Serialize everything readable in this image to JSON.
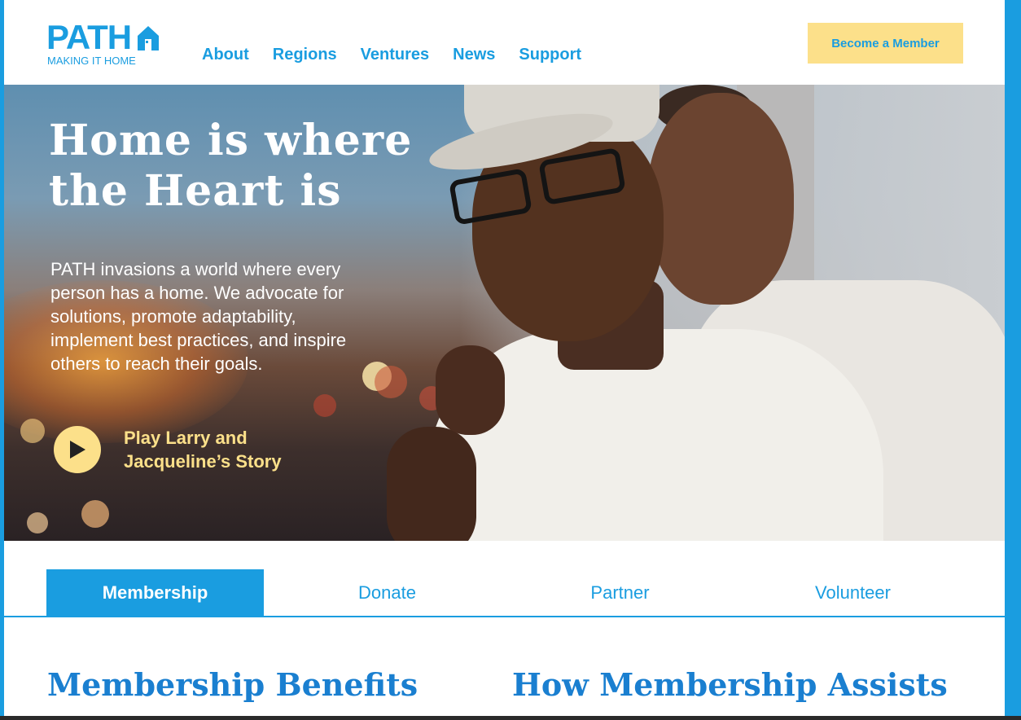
{
  "brand": {
    "name": "PATH",
    "tagline": "MAKING IT HOME"
  },
  "nav": {
    "items": [
      {
        "label": "About"
      },
      {
        "label": "Regions"
      },
      {
        "label": "Ventures"
      },
      {
        "label": "News"
      },
      {
        "label": "Support"
      }
    ],
    "cta_label": "Become a Member"
  },
  "hero": {
    "title": "Home is where the Heart is",
    "description": "PATH invasions a world where every person has a home. We advocate for solutions, promote adaptability, implement best practices, and inspire others to reach their goals.",
    "play_label": "Play Larry and Jacqueline’s Story"
  },
  "tabs": [
    {
      "label": "Membership",
      "active": true
    },
    {
      "label": "Donate",
      "active": false
    },
    {
      "label": "Partner",
      "active": false
    },
    {
      "label": "Volunteer",
      "active": false
    }
  ],
  "sections": {
    "left_title": "Membership Benefits",
    "right_title": "How Membership Assists"
  },
  "colors": {
    "brand_blue": "#1a9de0",
    "accent_yellow": "#fce08a"
  },
  "icons": {
    "play": "play-icon",
    "logo_house": "house-icon"
  }
}
